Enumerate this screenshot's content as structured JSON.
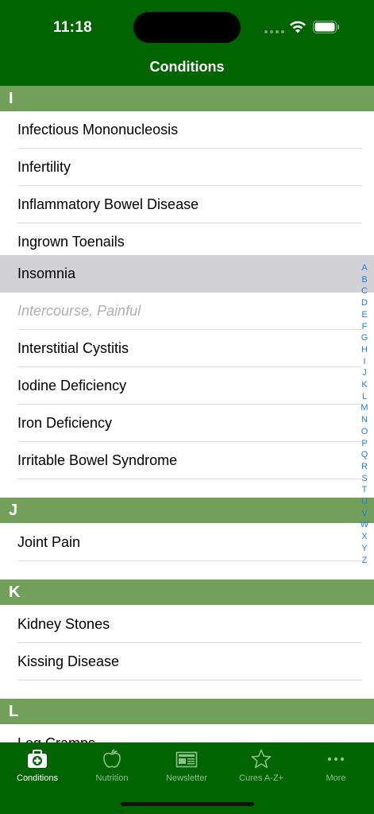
{
  "status_bar": {
    "time": "11:18"
  },
  "nav": {
    "title": "Conditions"
  },
  "sections": [
    {
      "letter": "I",
      "items": [
        "Infectious Mononucleosis",
        "Infertility",
        "Inflammatory Bowel Disease",
        "Ingrown Toenails",
        "Insomnia",
        "Intercourse, Painful",
        "Interstitial Cystitis",
        "Iodine Deficiency",
        "Iron Deficiency",
        "Irritable Bowel Syndrome"
      ]
    },
    {
      "letter": "J",
      "items": [
        "Joint Pain"
      ]
    },
    {
      "letter": "K",
      "items": [
        "Kidney Stones",
        "Kissing Disease"
      ]
    },
    {
      "letter": "L",
      "items": [
        "Leg Cramps"
      ]
    }
  ],
  "selected_item": "Insomnia",
  "disabled_item": "Intercourse, Painful",
  "index_letters": [
    "A",
    "B",
    "C",
    "D",
    "E",
    "F",
    "G",
    "H",
    "I",
    "J",
    "K",
    "L",
    "M",
    "N",
    "O",
    "P",
    "Q",
    "R",
    "S",
    "T",
    "U",
    "V",
    "W",
    "X",
    "Y",
    "Z"
  ],
  "tabs": [
    {
      "label": "Conditions",
      "icon": "medical-kit-icon",
      "active": true
    },
    {
      "label": "Nutrition",
      "icon": "apple-icon",
      "active": false
    },
    {
      "label": "Newsletter",
      "icon": "newspaper-icon",
      "active": false
    },
    {
      "label": "Cures A-Z+",
      "icon": "star-icon",
      "active": false
    },
    {
      "label": "More",
      "icon": "more-icon",
      "active": false
    }
  ],
  "colors": {
    "header": "#006400",
    "section": "#72a05a",
    "index": "#1a7ff0",
    "selected_row": "#d1d1d6"
  }
}
